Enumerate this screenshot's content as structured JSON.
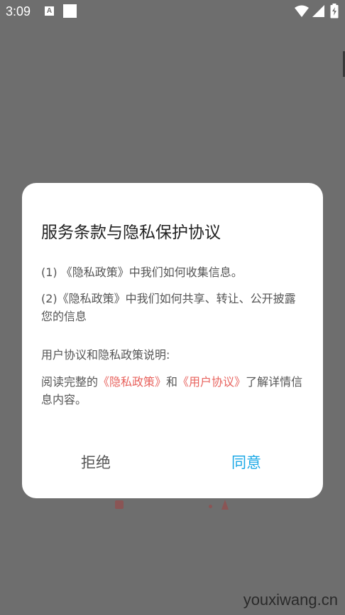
{
  "status_bar": {
    "time": "3:09",
    "notification_icon_letter": "A"
  },
  "dialog": {
    "title": "服务条款与隐私保护协议",
    "p1": "(1) 《隐私政策》中我们如何收集信息。",
    "p2": "(2)《隐私政策》中我们如何共享、转让、公开披露您的信息",
    "p3": "用户协议和隐私政策说明:",
    "p4": {
      "prefix": "阅读完整的",
      "privacy_link": "《隐私政策》",
      "and": "和",
      "user_link": "《用户协议》",
      "suffix": "了解详情信息内容。"
    },
    "reject_label": "拒绝",
    "agree_label": "同意"
  },
  "watermark": "youxiwang.cn",
  "colors": {
    "overlay": "#6e6e6e",
    "link": "#e8635e",
    "agree": "#1aa8e6"
  }
}
